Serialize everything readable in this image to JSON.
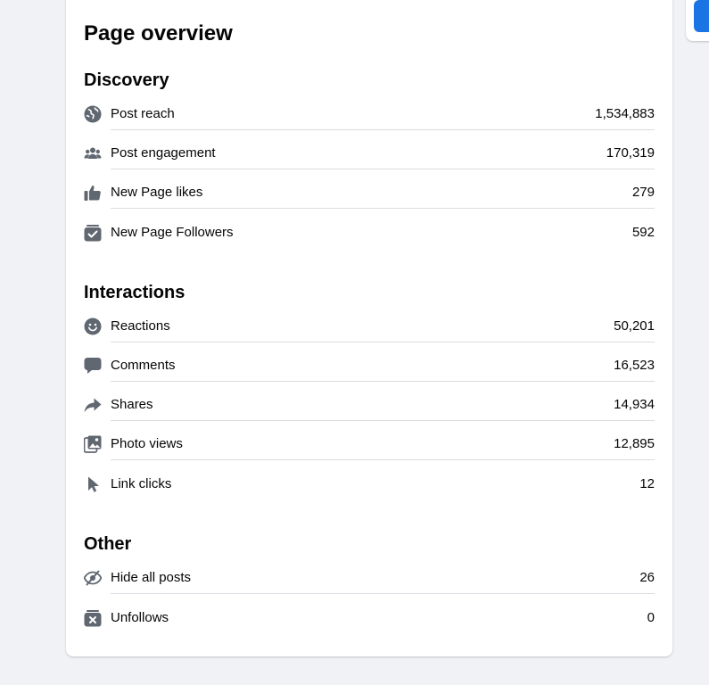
{
  "page_title": "Page overview",
  "colors": {
    "icon": "#606770",
    "accent": "#1b74e4",
    "divider": "#dadde1"
  },
  "sections": {
    "discovery": {
      "title": "Discovery",
      "items": [
        {
          "icon": "globe-icon",
          "label": "Post reach",
          "value": "1,534,883"
        },
        {
          "icon": "people-icon",
          "label": "Post engagement",
          "value": "170,319"
        },
        {
          "icon": "thumbs-up-icon",
          "label": "New Page likes",
          "value": "279"
        },
        {
          "icon": "follow-check-icon",
          "label": "New Page Followers",
          "value": "592"
        }
      ]
    },
    "interactions": {
      "title": "Interactions",
      "items": [
        {
          "icon": "smiley-icon",
          "label": "Reactions",
          "value": "50,201"
        },
        {
          "icon": "comment-icon",
          "label": "Comments",
          "value": "16,523"
        },
        {
          "icon": "share-icon",
          "label": "Shares",
          "value": "14,934"
        },
        {
          "icon": "photos-icon",
          "label": "Photo views",
          "value": "12,895"
        },
        {
          "icon": "cursor-icon",
          "label": "Link clicks",
          "value": "12"
        }
      ]
    },
    "other": {
      "title": "Other",
      "items": [
        {
          "icon": "eye-hidden-icon",
          "label": "Hide all posts",
          "value": "26"
        },
        {
          "icon": "unfollow-icon",
          "label": "Unfollows",
          "value": "0"
        }
      ]
    }
  }
}
